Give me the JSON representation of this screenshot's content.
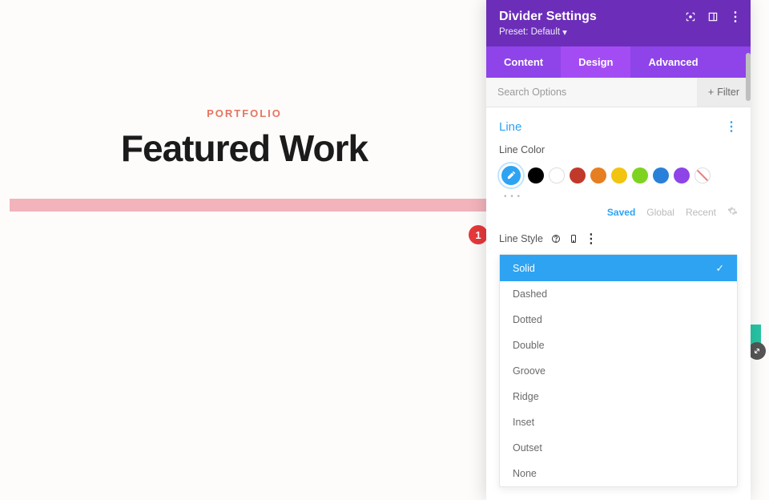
{
  "canvas": {
    "portfolio_label": "PORTFOLIO",
    "featured_title": "Featured Work",
    "annotation_number": "1"
  },
  "panel": {
    "title": "Divider Settings",
    "preset_label": "Preset: Default",
    "tabs": {
      "content": "Content",
      "design": "Design",
      "advanced": "Advanced"
    },
    "search_placeholder": "Search Options",
    "filter_label": "Filter",
    "section": {
      "title": "Line",
      "color_label": "Line Color",
      "palette_tabs": {
        "saved": "Saved",
        "global": "Global",
        "recent": "Recent"
      },
      "style_label": "Line Style"
    },
    "line_styles": [
      "Solid",
      "Dashed",
      "Dotted",
      "Double",
      "Groove",
      "Ridge",
      "Inset",
      "Outset",
      "None"
    ],
    "selected_style": "Solid",
    "colors": {
      "black": "#000000",
      "white": "#ffffff",
      "red": "#c0392b",
      "orange": "#e67e22",
      "yellow": "#f1c40f",
      "green": "#7ed321",
      "blue": "#2980d9",
      "purple": "#8e44e6"
    }
  }
}
